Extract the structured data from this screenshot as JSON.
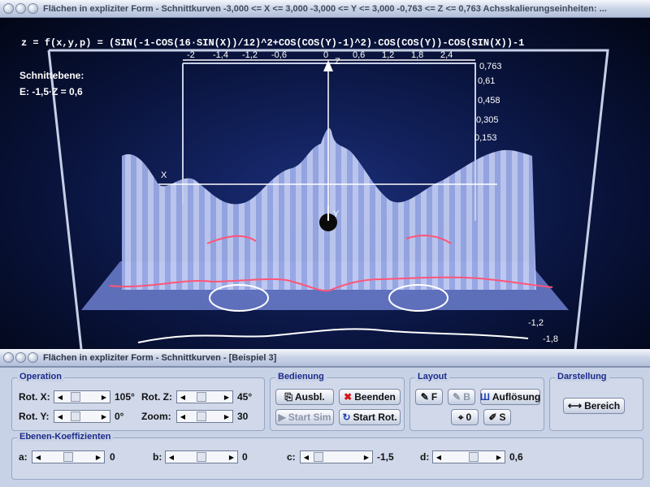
{
  "window_top": {
    "title": "Flächen in expliziter Form - Schnittkurven   -3,000 <= X <= 3,000   -3,000 <= Y <= 3,000   -0,763 <= Z <= 0,763   Achsskalierungseinheiten:  ..."
  },
  "viewport": {
    "formula": "z = f(x,y,p) = (SIN(-1-COS(16·SIN(X))/12)^2+COS(COS(Y)-1)^2)·COS(COS(Y))-COS(SIN(X))-1",
    "section_label": "Schnittebene:",
    "section_eq": "E: -1,5·Z = 0,6",
    "axis_x": "X",
    "axis_y": "Y",
    "axis_z": "Z",
    "z_ticks": [
      "0,763",
      "0,61",
      "0,458",
      "0,305",
      "0,153"
    ],
    "y_ticks": [
      "-1,2",
      "-1,8"
    ],
    "top_ticks": [
      "-2",
      "-1,4",
      "-1,2",
      "-0,6",
      "0",
      "0,6",
      "1,2",
      "1,8",
      "2,4"
    ]
  },
  "window_bottom": {
    "title": "Flächen in expliziter Form - Schnittkurven - [Beispiel 3]"
  },
  "operation": {
    "label": "Operation",
    "rot_x_label": "Rot. X:",
    "rot_x_value": "105°",
    "rot_y_label": "Rot. Y:",
    "rot_y_value": "0°",
    "rot_z_label": "Rot. Z:",
    "rot_z_value": "45°",
    "zoom_label": "Zoom:",
    "zoom_value": "30"
  },
  "bedienung": {
    "label": "Bedienung",
    "ausbl": "Ausbl.",
    "beenden": "Beenden",
    "start_sim": "Start Sim",
    "start_rot": "Start Rot."
  },
  "layout": {
    "label": "Layout",
    "f": "F",
    "b": "B",
    "aufloesung": "Auflösung",
    "zero": "0",
    "s": "S"
  },
  "darstellung": {
    "label": "Darstellung",
    "bereich": "Bereich"
  },
  "ebenen": {
    "label": "Ebenen-Koeffizienten",
    "a_label": "a:",
    "a_value": "0",
    "b_label": "b:",
    "b_value": "0",
    "c_label": "c:",
    "c_value": "-1,5",
    "d_label": "d:",
    "d_value": "0,6"
  },
  "colors": {
    "accent": "#1d2a8a",
    "surface": "#9fb0e8",
    "cut_curve": "#ff5577"
  }
}
